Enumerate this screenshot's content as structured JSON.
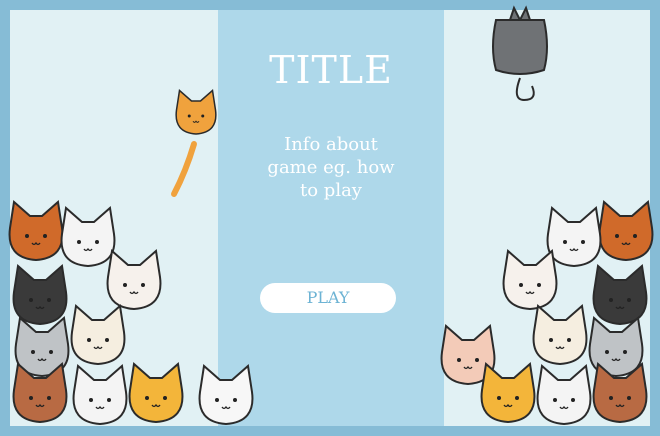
{
  "title": "TITLE",
  "info_text": "Info about game eg. how to play",
  "play_button_label": "PLAY",
  "colors": {
    "frame": "#86bcd6",
    "side_panel": "#e1f1f4",
    "center_panel": "#aed8ea",
    "text": "#ffffff",
    "button_text": "#6db3d4"
  },
  "decor": {
    "left_pile_icon": "cat-pile-icon",
    "right_pile_icon": "cat-pile-icon",
    "falling_orange_icon": "falling-cat-icon",
    "falling_gray_icon": "falling-cat-icon"
  }
}
